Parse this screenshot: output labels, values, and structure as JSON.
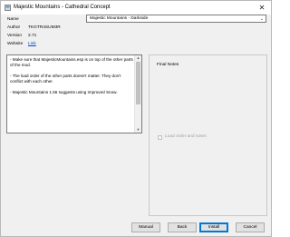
{
  "window": {
    "title": "Majestic Mountains - Cathedral Concept",
    "close_glyph": "✕"
  },
  "form": {
    "name_label": "Name",
    "name_value": "Majestic Mountains - Darkside",
    "author_label": "Author",
    "author_value": "TKGTR4SUM3R",
    "version_label": "Version",
    "version_value": "2.71",
    "website_label": "Website",
    "website_value": "Link"
  },
  "notes": [
    "- Make sure that MajesticMountains.esp is on top of the other parts of the mod.",
    "- The load order of the other parts doesn't matter. They don't conflict with each other.",
    "- Majestic Mountains 1.56 suggests using Improved Snow."
  ],
  "final_notes": {
    "title": "Final Notes",
    "checkbox_label": "Load order and notes"
  },
  "buttons": {
    "manual": "Manual",
    "back": "Back",
    "install": "Install",
    "cancel": "Cancel"
  },
  "icons": {
    "app": "installer-icon",
    "dropdown": "chevron-down-icon"
  }
}
